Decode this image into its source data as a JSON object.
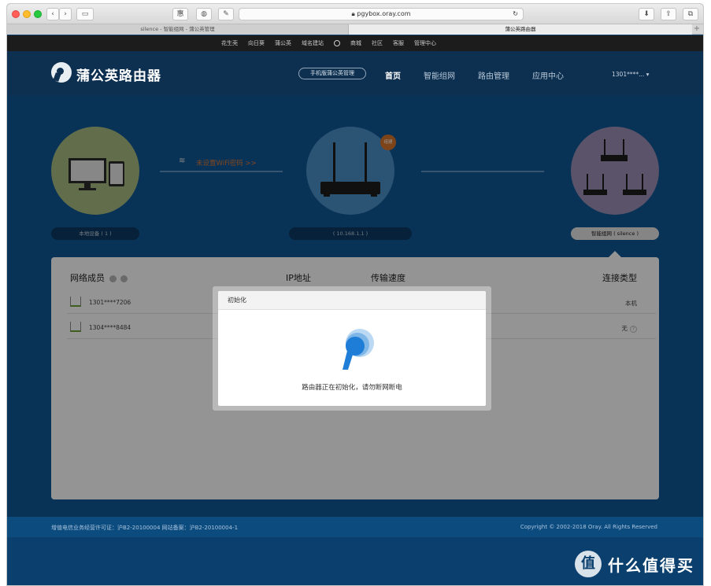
{
  "browser": {
    "url": "pgybox.oray.com",
    "toolbar_btn1": "惠",
    "toolbar_btn3": "✎",
    "tabs": [
      {
        "label": "silence - 智能组网 - 蒲公英管理"
      },
      {
        "label": "蒲公英路由器"
      }
    ],
    "new_tab": "+"
  },
  "topnav": {
    "items": [
      "花生壳",
      "向日葵",
      "蒲公英",
      "域名建站"
    ],
    "items2": [
      "商城",
      "社区",
      "客服",
      "管理中心"
    ]
  },
  "header": {
    "brand": "蒲公英路由器",
    "mobile_manage": "手机版蒲公英管理",
    "nav": [
      "首页",
      "智能组网",
      "路由管理",
      "应用中心"
    ],
    "user": "1301****... ▾"
  },
  "diagram": {
    "wifi_warning": "未设置WiFi密码 >>",
    "badge": "组建",
    "left_pill": "本地设备 ( 1 )",
    "mid_pill": "( 10.168.1.1 )",
    "right_pill": "智能组网 ( silence )"
  },
  "members": {
    "headers": {
      "members": "网络成员",
      "ip": "IP地址",
      "speed": "传输速度",
      "type": "连接类型"
    },
    "rows": [
      {
        "name": "1301****7206",
        "type": "本机"
      },
      {
        "name": "1304****8484",
        "type": "无",
        "help": "?"
      }
    ]
  },
  "modal": {
    "title": "初始化",
    "message": "路由器正在初始化，请勿断网断电"
  },
  "footer": {
    "left": "增值电信业务经营许可证：沪B2-20100004  网站备案：沪B2-20100004-1",
    "right": "Copyright © 2002-2018 Oray. All Rights Reserved"
  },
  "watermark": {
    "logo": "值",
    "text": "什么值得买"
  },
  "colors": {
    "page_blue": "#0e5895",
    "header_dark": "#0d2f50",
    "warning_orange": "#e07a3a",
    "spinner_blue": "#1e7dd6"
  }
}
